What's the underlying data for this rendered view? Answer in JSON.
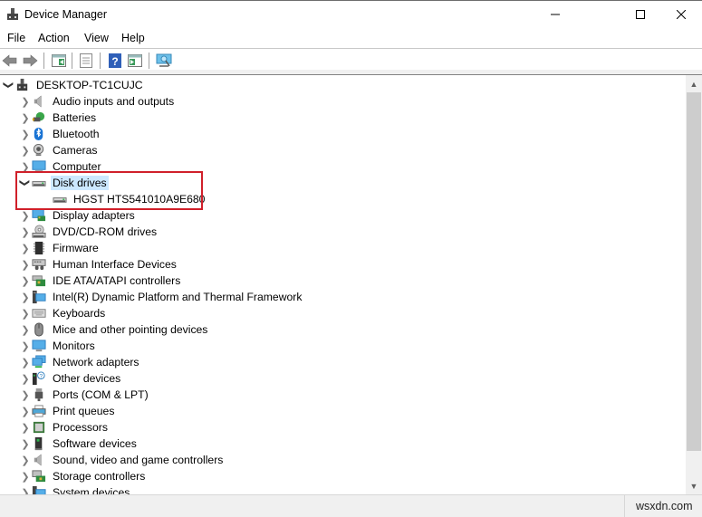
{
  "window": {
    "title": "Device Manager",
    "minimize_icon": "minimize-icon",
    "maximize_icon": "maximize-icon",
    "close_icon": "close-icon"
  },
  "menu": [
    "File",
    "Action",
    "View",
    "Help"
  ],
  "toolbar": [
    {
      "name": "back-button",
      "icon": "arrow-left-icon"
    },
    {
      "name": "forward-button",
      "icon": "arrow-right-icon"
    },
    {
      "name": "show-hide-console-tree-button",
      "icon": "console-tree-icon"
    },
    {
      "name": "properties-button",
      "icon": "properties-icon"
    },
    {
      "name": "help-button",
      "icon": "help-icon"
    },
    {
      "name": "show-hide-action-pane-button",
      "icon": "action-pane-icon"
    },
    {
      "name": "scan-hardware-button",
      "icon": "monitor-scan-icon"
    }
  ],
  "tree": {
    "root": {
      "label": "DESKTOP-TC1CUJC",
      "expanded": true,
      "icon": "computer-root-icon"
    },
    "categories": [
      {
        "label": "Audio inputs and outputs",
        "icon": "speaker-icon"
      },
      {
        "label": "Batteries",
        "icon": "battery-icon"
      },
      {
        "label": "Bluetooth",
        "icon": "bluetooth-icon"
      },
      {
        "label": "Cameras",
        "icon": "camera-icon"
      },
      {
        "label": "Computer",
        "icon": "computer-icon"
      },
      {
        "label": "Disk drives",
        "icon": "disk-drive-icon",
        "expanded": true,
        "selected": true,
        "children": [
          {
            "label": "HGST HTS541010A9E680",
            "icon": "disk-drive-icon"
          }
        ]
      },
      {
        "label": "Display adapters",
        "icon": "display-adapter-icon"
      },
      {
        "label": "DVD/CD-ROM drives",
        "icon": "dvd-drive-icon"
      },
      {
        "label": "Firmware",
        "icon": "firmware-icon"
      },
      {
        "label": "Human Interface Devices",
        "icon": "hid-icon"
      },
      {
        "label": "IDE ATA/ATAPI controllers",
        "icon": "ide-controller-icon"
      },
      {
        "label": "Intel(R) Dynamic Platform and Thermal Framework",
        "icon": "intel-framework-icon"
      },
      {
        "label": "Keyboards",
        "icon": "keyboard-icon"
      },
      {
        "label": "Mice and other pointing devices",
        "icon": "mouse-icon"
      },
      {
        "label": "Monitors",
        "icon": "monitor-icon"
      },
      {
        "label": "Network adapters",
        "icon": "network-adapter-icon"
      },
      {
        "label": "Other devices",
        "icon": "unknown-device-icon"
      },
      {
        "label": "Ports (COM & LPT)",
        "icon": "port-icon"
      },
      {
        "label": "Print queues",
        "icon": "printer-icon"
      },
      {
        "label": "Processors",
        "icon": "processor-icon"
      },
      {
        "label": "Software devices",
        "icon": "software-device-icon"
      },
      {
        "label": "Sound, video and game controllers",
        "icon": "speaker-icon"
      },
      {
        "label": "Storage controllers",
        "icon": "storage-controller-icon"
      },
      {
        "label": "System devices",
        "icon": "system-device-icon"
      }
    ]
  },
  "highlight": {
    "color": "#d0202a",
    "target": "Disk drives"
  },
  "selection_color": "#cce8ff",
  "status": {
    "right_text": "wsxdn.com"
  }
}
